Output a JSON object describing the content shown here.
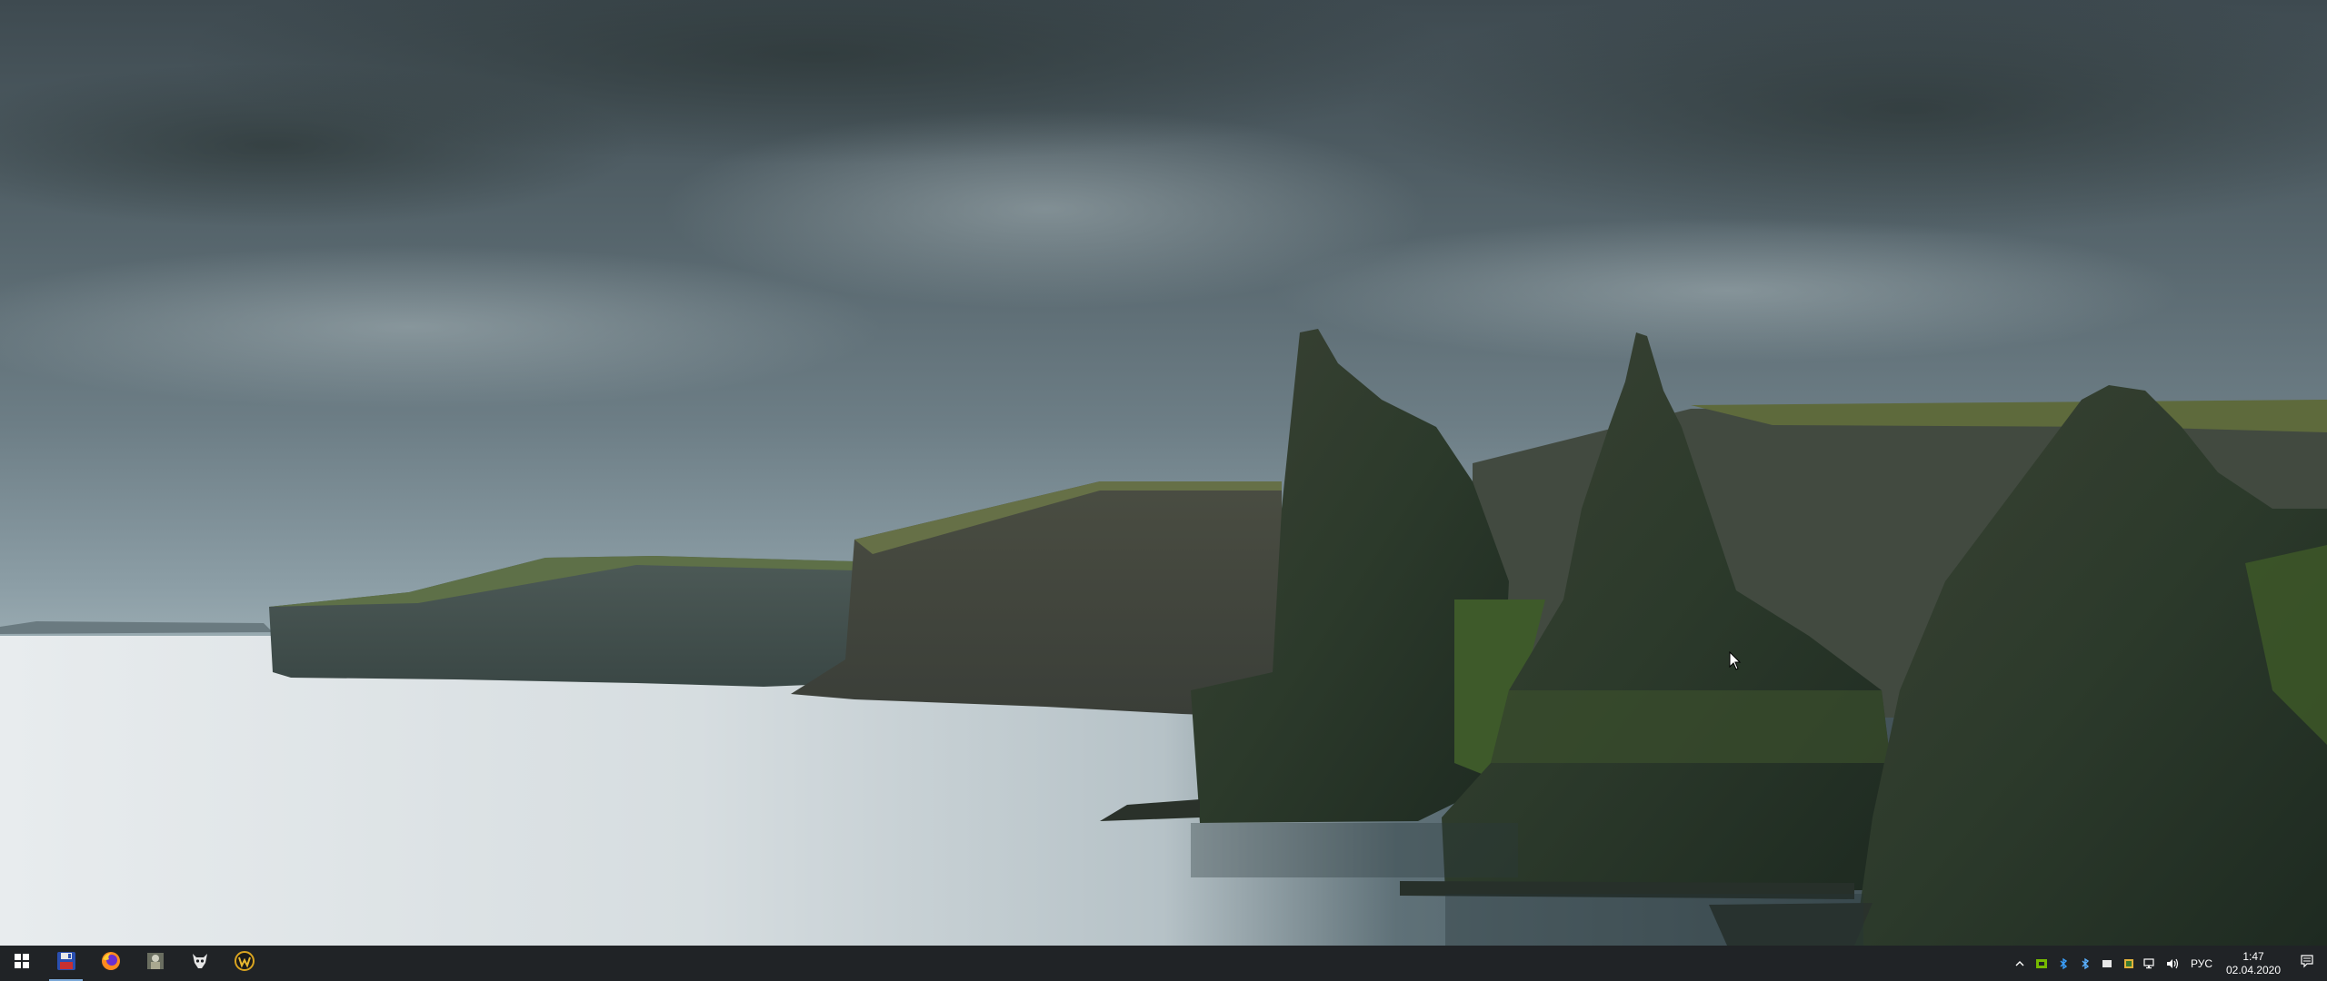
{
  "desktop": {
    "wallpaper": "sea-cliffs-landscape"
  },
  "taskbar": {
    "background": "#202326",
    "pinned": [
      {
        "name": "start-button",
        "icon": "windows-logo-icon"
      },
      {
        "name": "taskbar-app-save",
        "icon": "floppy-disk-icon"
      },
      {
        "name": "taskbar-app-firefox",
        "icon": "firefox-icon"
      },
      {
        "name": "taskbar-app-game-figure",
        "icon": "armored-figure-icon"
      },
      {
        "name": "taskbar-app-skull",
        "icon": "skull-icon"
      },
      {
        "name": "taskbar-app-warcraft",
        "icon": "warcraft-w-icon"
      }
    ],
    "tray": {
      "language": "РУС",
      "time": "1:47",
      "date": "02.04.2020"
    }
  }
}
